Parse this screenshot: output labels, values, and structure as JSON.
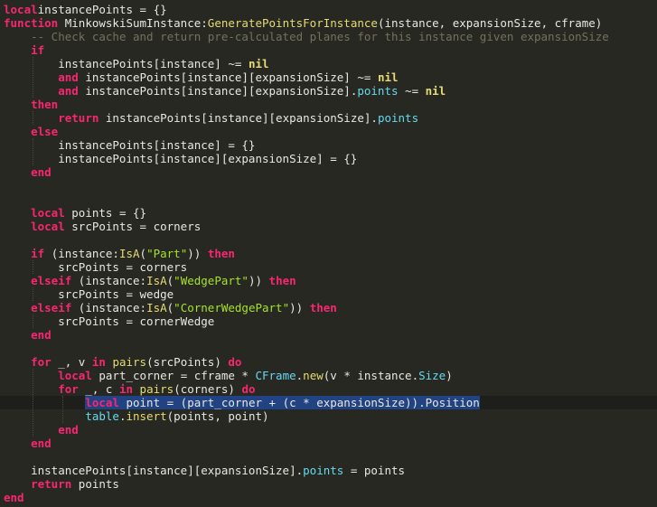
{
  "colors": {
    "background": "#272822",
    "keyword": "#f92672",
    "function": "#e6db74",
    "string": "#a6e22e",
    "comment": "#75715e",
    "property": "#66d9ef",
    "selection": "#214283"
  },
  "lines": [
    [
      [
        "kw",
        "local"
      ],
      [
        "",
        "instancePoints = {}"
      ]
    ],
    [
      [
        "kw",
        "function"
      ],
      [
        "",
        " MinkowskiSumInstance:"
      ],
      [
        "fn",
        "GeneratePointsForInstance"
      ],
      [
        "",
        "(instance, expansionSize, cframe)"
      ]
    ],
    [
      [
        "",
        "    "
      ],
      [
        "cm",
        "-- Check cache and return pre-calculated planes for this instance given expansionSize"
      ]
    ],
    [
      [
        "",
        "    "
      ],
      [
        "kw",
        "if"
      ]
    ],
    [
      [
        "",
        "        instancePoints[instance] ~= "
      ],
      [
        "nil",
        "nil"
      ]
    ],
    [
      [
        "",
        "        "
      ],
      [
        "kw",
        "and"
      ],
      [
        "",
        " instancePoints[instance][expansionSize] ~= "
      ],
      [
        "nil",
        "nil"
      ]
    ],
    [
      [
        "",
        "        "
      ],
      [
        "kw",
        "and"
      ],
      [
        "",
        " instancePoints[instance][expansionSize]."
      ],
      [
        "prop",
        "points"
      ],
      [
        "",
        " ~= "
      ],
      [
        "nil",
        "nil"
      ]
    ],
    [
      [
        "",
        "    "
      ],
      [
        "kw",
        "then"
      ]
    ],
    [
      [
        "",
        "        "
      ],
      [
        "kw",
        "return"
      ],
      [
        "",
        " instancePoints[instance][expansionSize]."
      ],
      [
        "prop",
        "points"
      ]
    ],
    [
      [
        "",
        "    "
      ],
      [
        "kw",
        "else"
      ]
    ],
    [
      [
        "",
        "        instancePoints[instance] = {}"
      ]
    ],
    [
      [
        "",
        "        instancePoints[instance][expansionSize] = {}"
      ]
    ],
    [
      [
        "",
        "    "
      ],
      [
        "kw",
        "end"
      ]
    ],
    [
      [
        "",
        ""
      ]
    ],
    [
      [
        "",
        ""
      ]
    ],
    [
      [
        "",
        "    "
      ],
      [
        "kw",
        "local"
      ],
      [
        "",
        " points = {}"
      ]
    ],
    [
      [
        "",
        "    "
      ],
      [
        "kw",
        "local"
      ],
      [
        "",
        " srcPoints = corners"
      ]
    ],
    [
      [
        "",
        ""
      ]
    ],
    [
      [
        "",
        "    "
      ],
      [
        "kw",
        "if"
      ],
      [
        "",
        " (instance:"
      ],
      [
        "fn",
        "IsA"
      ],
      [
        "",
        "("
      ],
      [
        "str",
        "\"Part\""
      ],
      [
        "",
        "))"
      ],
      [
        "kw",
        " then"
      ]
    ],
    [
      [
        "",
        "        srcPoints = corners"
      ]
    ],
    [
      [
        "",
        "    "
      ],
      [
        "kw",
        "elseif"
      ],
      [
        "",
        " (instance:"
      ],
      [
        "fn",
        "IsA"
      ],
      [
        "",
        "("
      ],
      [
        "str",
        "\"WedgePart\""
      ],
      [
        "",
        "))"
      ],
      [
        "kw",
        " then"
      ]
    ],
    [
      [
        "",
        "        srcPoints = wedge"
      ]
    ],
    [
      [
        "",
        "    "
      ],
      [
        "kw",
        "elseif"
      ],
      [
        "",
        " (instance:"
      ],
      [
        "fn",
        "IsA"
      ],
      [
        "",
        "("
      ],
      [
        "str",
        "\"CornerWedgePart\""
      ],
      [
        "",
        "))"
      ],
      [
        "kw",
        " then"
      ]
    ],
    [
      [
        "",
        "        srcPoints = cornerWedge"
      ]
    ],
    [
      [
        "",
        "    "
      ],
      [
        "kw",
        "end"
      ]
    ],
    [
      [
        "",
        ""
      ]
    ],
    [
      [
        "",
        "    "
      ],
      [
        "kw",
        "for"
      ],
      [
        "",
        " _, v "
      ],
      [
        "kw",
        "in"
      ],
      [
        "",
        " "
      ],
      [
        "fn",
        "pairs"
      ],
      [
        "",
        "(srcPoints) "
      ],
      [
        "kw",
        "do"
      ]
    ],
    [
      [
        "",
        "        "
      ],
      [
        "kw",
        "local"
      ],
      [
        "",
        " part_corner = cframe * "
      ],
      [
        "gl",
        "CFrame"
      ],
      [
        "",
        "."
      ],
      [
        "fn",
        "new"
      ],
      [
        "",
        "(v * instance."
      ],
      [
        "prop",
        "Size"
      ],
      [
        "",
        ")"
      ]
    ],
    [
      [
        "",
        "        "
      ],
      [
        "kw",
        "for"
      ],
      [
        "",
        " _, c "
      ],
      [
        "kw",
        "in"
      ],
      [
        "",
        " "
      ],
      [
        "fn",
        "pairs"
      ],
      [
        "",
        "(corners) "
      ],
      [
        "kw",
        "do"
      ]
    ],
    [
      [
        "",
        "            "
      ],
      [
        "kw sel",
        "local"
      ],
      [
        "sel",
        " point = (part_corner + (c * expansionSize)).Position"
      ]
    ],
    [
      [
        "",
        "            "
      ],
      [
        "gl",
        "table"
      ],
      [
        "",
        "."
      ],
      [
        "fn",
        "insert"
      ],
      [
        "",
        "(points, point)"
      ]
    ],
    [
      [
        "",
        "        "
      ],
      [
        "kw",
        "end"
      ]
    ],
    [
      [
        "",
        "    "
      ],
      [
        "kw",
        "end"
      ]
    ],
    [
      [
        "",
        ""
      ]
    ],
    [
      [
        "",
        "    instancePoints[instance][expansionSize]."
      ],
      [
        "prop",
        "points"
      ],
      [
        "",
        " = points"
      ]
    ],
    [
      [
        "",
        "    "
      ],
      [
        "kw",
        "return"
      ],
      [
        "",
        " points"
      ]
    ],
    [
      [
        "kw",
        "end"
      ]
    ]
  ]
}
